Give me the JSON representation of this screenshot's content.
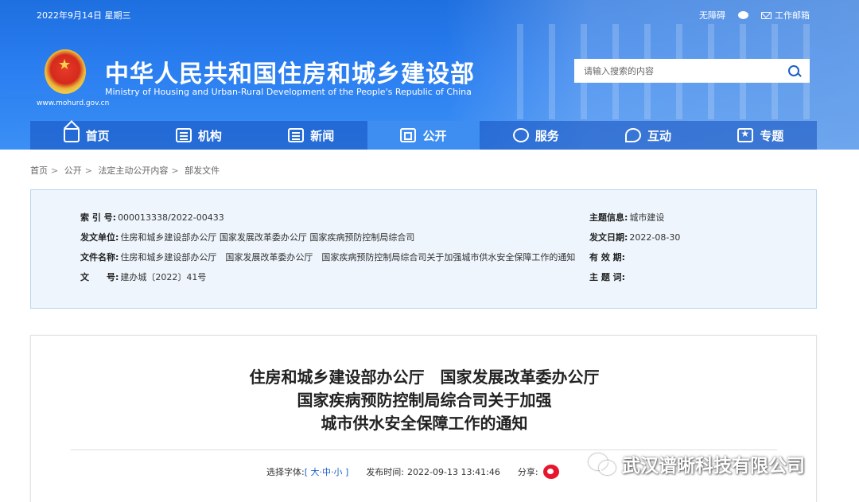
{
  "topbar": {
    "date": "2022年9月14日 星期三",
    "accessibility": "无障碍",
    "wechat_icon": "wechat-icon",
    "mail_label": "工作邮箱"
  },
  "header": {
    "url": "www.mohurd.gov.cn",
    "title": "中华人民共和国住房和城乡建设部",
    "subtitle": "Ministry of Housing and Urban-Rural Development of the People's Republic of China",
    "emblem_icon": "national-emblem"
  },
  "search": {
    "placeholder": "请输入搜索的内容"
  },
  "nav": {
    "items": [
      {
        "label": "首页",
        "icon": "home-icon"
      },
      {
        "label": "机构",
        "icon": "building-icon"
      },
      {
        "label": "新闻",
        "icon": "news-icon"
      },
      {
        "label": "公开",
        "icon": "document-icon",
        "active": true
      },
      {
        "label": "服务",
        "icon": "service-icon"
      },
      {
        "label": "互动",
        "icon": "chat-icon"
      },
      {
        "label": "专题",
        "icon": "star-icon"
      }
    ]
  },
  "breadcrumb": [
    "首页",
    "公开",
    "法定主动公开内容",
    "部发文件"
  ],
  "info": {
    "index_label": "索 引 号:",
    "index_value": "000013338/2022-00433",
    "issuer_label": "发文单位:",
    "issuer_value": "住房和城乡建设部办公厅 国家发展改革委办公厅 国家疾病预防控制局综合司",
    "docname_label": "文件名称:",
    "docname_value": "住房和城乡建设部办公厅　国家发展改革委办公厅　国家疾病预防控制局综合司关于加强城市供水安全保障工作的通知",
    "docno_label": "文　　号:",
    "docno_value": "建办城〔2022〕41号",
    "subject_label": "主题信息:",
    "subject_value": "城市建设",
    "date_label": "发文日期:",
    "date_value": "2022-08-30",
    "validity_label": "有 效 期:",
    "keywords_label": "主 题 词:"
  },
  "article": {
    "title_line1": "住房和城乡建设部办公厅　国家发展改革委办公厅",
    "title_line2": "国家疾病预防控制局综合司关于加强",
    "title_line3": "城市供水安全保障工作的通知",
    "font_label": "选择字体:",
    "font_open": "[",
    "font_large": "大",
    "font_mid": "中",
    "font_small": "小",
    "font_close": "]",
    "font_sep": "·",
    "publish_label": "发布时间:",
    "publish_time": "2022-09-13 13:41:46",
    "share_label": "分享:"
  },
  "watermark": {
    "text": "武汉谱晰科技有限公司"
  }
}
